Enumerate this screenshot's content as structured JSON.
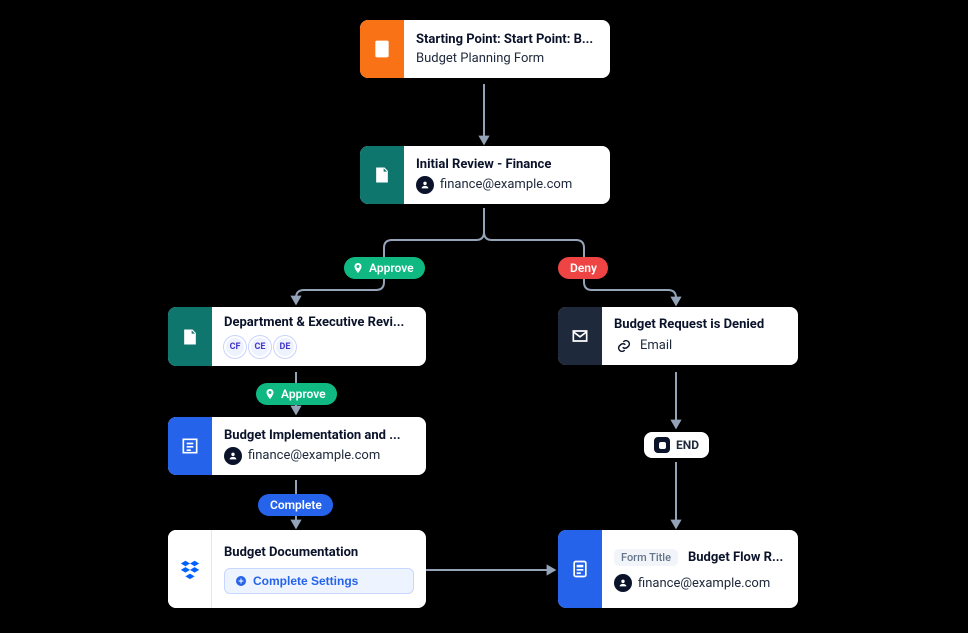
{
  "colors": {
    "orange": "#f97316",
    "teal": "#0f766e",
    "navy": "#1e293b",
    "blue": "#2563eb",
    "green": "#10b981",
    "red": "#ef4444",
    "dropbox": "#0061ff"
  },
  "branches": {
    "approve": "Approve",
    "deny": "Deny",
    "complete": "Complete"
  },
  "nodes": {
    "start": {
      "title": "Starting Point: Start Point: B...",
      "subtitle": "Budget Planning Form"
    },
    "initialReview": {
      "title": "Initial Review - Finance",
      "assignee": "finance@example.com"
    },
    "deptReview": {
      "title": "Department & Executive Revi...",
      "avatars": [
        "CF",
        "CE",
        "DE"
      ]
    },
    "denied": {
      "title": "Budget Request is Denied",
      "subtitle": "Email"
    },
    "implementation": {
      "title": "Budget Implementation and ...",
      "assignee": "finance@example.com"
    },
    "end": {
      "label": "END"
    },
    "documentation": {
      "title": "Budget Documentation",
      "button": "Complete Settings"
    },
    "flowResult": {
      "tag": "Form Title",
      "title": "Budget Flow R...",
      "assignee": "finance@example.com"
    }
  }
}
